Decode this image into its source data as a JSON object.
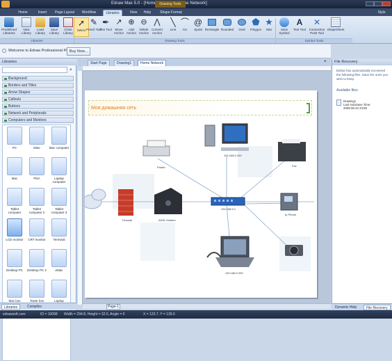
{
  "window": {
    "title": "Edraw Max 5.0 - [Home Network - Home Network]",
    "context_tab": "Drawing Tools"
  },
  "ribbon_tabs": [
    "Home",
    "Insert",
    "Page Layout",
    "Workflow",
    "Libraries",
    "View",
    "Help",
    "Shape Format"
  ],
  "ribbon_right": "Style",
  "ribbon": {
    "libraries_buttons": [
      "Predefined Libraries",
      "New Library",
      "Load Library",
      "Save Library",
      "Close Library"
    ],
    "drawing_buttons": [
      "Select",
      "Pencil Tool",
      "Pen Tool",
      "Move Anchor",
      "Add Anchor",
      "Delete Anchor",
      "Convert Anchor",
      "Line",
      "Arc",
      "Spiral",
      "Rectangle",
      "Rounded",
      "Oval",
      "Polygon",
      "Star"
    ],
    "symbol_buttons": [
      "Save Symbol",
      "Text Tool",
      "Connection Point Tool",
      "ShapeSheet"
    ],
    "groups": [
      "Libraries",
      "Drawing Tools",
      "Symbol Tools"
    ]
  },
  "message": {
    "text": "Welcome to Edraw Professional 4!",
    "button": "Buy Now..."
  },
  "library": {
    "title": "Libraries",
    "categories": [
      "Background",
      "Borders and Titles",
      "Arrow Shapes",
      "Callouts",
      "Buttons",
      "Network and Peripherals",
      "Computers and Monitors"
    ],
    "shapes": [
      "PC",
      "iMac",
      "Mac computer",
      "Mac",
      "PDA",
      "Laptop computer",
      "Tablet computer",
      "Tablet computer 2",
      "Tablet computer 3",
      "LCD monitor",
      "CRT monitor",
      "Terminal",
      "Desktop PC",
      "Desktop PC 2",
      "eMac",
      "Mac box",
      "Tower box",
      "Laptop computer 2"
    ],
    "bottom_tabs": [
      "Libraries",
      "Compiles"
    ]
  },
  "document_tabs": [
    "Start Page",
    "Drawing1",
    "Home Network"
  ],
  "diagram": {
    "banner": "Моя домашняя сеть",
    "labels": {
      "printer": "Printer",
      "pc": "192.168.0.100",
      "fax": "Fax",
      "router": "192.168.0.1",
      "firewall": "Firewall",
      "modem": "ADSL Modem",
      "phone": "Ip Phone",
      "laptop": "192.168.0.200"
    }
  },
  "page_tab": "Page-1",
  "recovery": {
    "title": "File Recovery",
    "body": "Edraw has automatically recovered the following files. Save the ones you wish to keep.",
    "available": "Available files:",
    "file": "Drawing1\nLast AutoSave Time:\n2009-06-22 23:59",
    "tabs": [
      "Dynamic Help",
      "File Recovery"
    ]
  },
  "status": {
    "site": "edrawsoft.com",
    "id": "ID = 10098",
    "size": "Width = 294.8, Height = 32.5, Angle = 0",
    "pos": "X = 123.7, Y = 139.0"
  }
}
